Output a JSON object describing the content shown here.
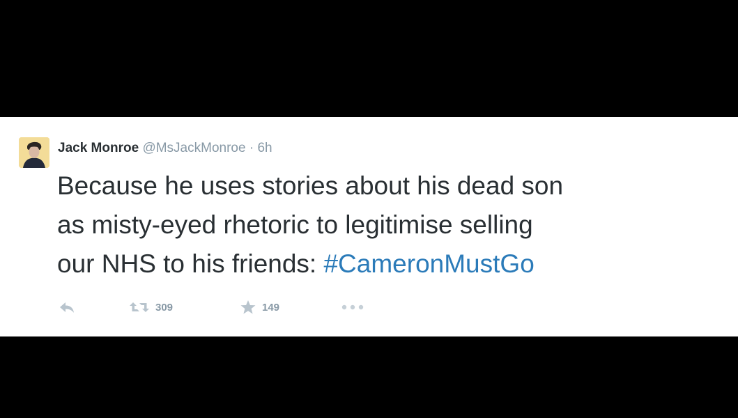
{
  "tweet": {
    "author_name": "Jack Monroe",
    "author_handle": "@MsJackMonroe",
    "separator": "·",
    "timestamp": "6h",
    "text_line1": "Because he uses stories about his dead son",
    "text_line2": "as misty-eyed rhetoric to legitimise selling",
    "text_line3_prefix": "our NHS to his friends: ",
    "hashtag": "#CameronMustGo",
    "retweet_count": "309",
    "favorite_count": "149"
  },
  "icons": {
    "reply": "reply-arrow-icon",
    "retweet": "retweet-icon",
    "favorite": "star-icon",
    "more": "ellipsis-icon"
  },
  "colors": {
    "text": "#292f33",
    "meta": "#8899a6",
    "hashtag": "#2b7bb9",
    "card_background": "#ffffff",
    "letterbox": "#000000"
  }
}
